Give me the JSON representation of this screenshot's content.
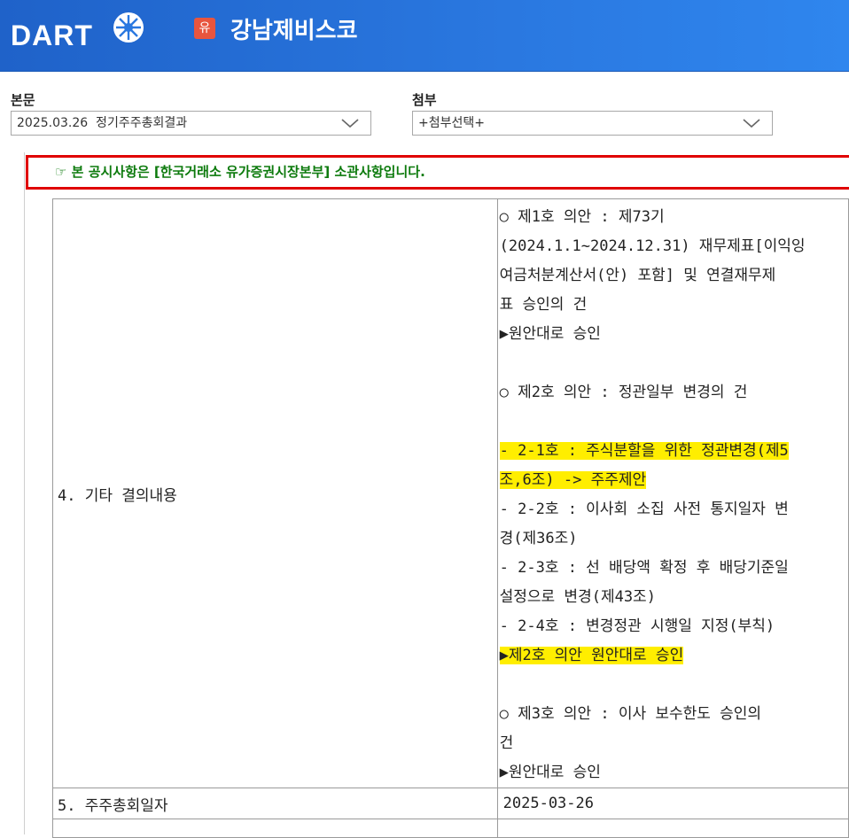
{
  "header": {
    "logo_text": "DART",
    "corp_badge": "유",
    "corp_name": "강남제비스코"
  },
  "body_select": {
    "label": "본문",
    "value": "2025.03.26  정기주주총회결과"
  },
  "attach_select": {
    "label": "첨부",
    "value": "+첨부선택+"
  },
  "notice": "☞ 본 공시사항은 [한국거래소 유가증권시장본부] 소관사항입니다.",
  "table": {
    "row4_label": "4. 기타 결의내용",
    "row4_lines": [
      "○ 제1호 의안 : 제73기",
      "(2024.1.1~2024.12.31) 재무제표[이익잉",
      "여금처분계산서(안) 포함] 및 연결재무제",
      "표 승인의 건",
      "▶원안대로 승인",
      "",
      "○ 제2호 의안 : 정관일부 변경의 건",
      "",
      "- 2-1호 : 주식분할을 위한 정관변경(제5",
      "조,6조) -> 주주제안",
      "- 2-2호 : 이사회 소집 사전 통지일자 변",
      "경(제36조)",
      "- 2-3호 : 선 배당액 확정 후 배당기준일",
      "설정으로 변경(제43조)",
      "- 2-4호 : 변경정관 시행일 지정(부칙)",
      "▶제2호 의안 원안대로 승인",
      "",
      "○ 제3호 의안 : 이사 보수한도 승인의",
      "건",
      "▶원안대로 승인"
    ],
    "row5_label": "5. 주주총회일자",
    "row5_value": "2025-03-26"
  },
  "colors": {
    "header_blue": "#2a78e0",
    "notice_border": "#e00000",
    "notice_text": "#0c7a0c",
    "highlight": "#ffee00"
  }
}
